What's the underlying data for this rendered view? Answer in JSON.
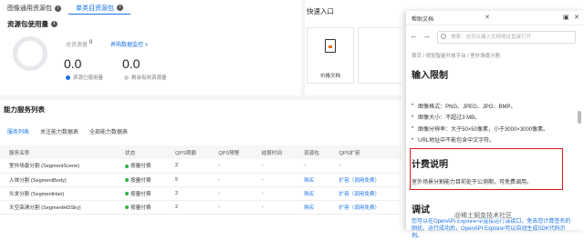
{
  "tabs": [
    {
      "label": "图像通用资源包",
      "active": false
    },
    {
      "label": "单类目资源包",
      "active": true
    }
  ],
  "usage": {
    "title": "资源包使用量",
    "total_label": "总资源量",
    "total_value": "0",
    "buy_link": "养购数据监控 >",
    "used_value": "0.0",
    "remaining_value": "0.0",
    "used_legend": "资源已使用量",
    "remaining_legend": "剩余有效资源量",
    "used_color": "#1a73e8",
    "remaining_color": "#e6e8eb"
  },
  "quick": {
    "title": "快速入口",
    "tile_label": "价格文档"
  },
  "ability": {
    "title": "能力服务列表",
    "subtabs": [
      "服务列表",
      "关注能力数据表",
      "全部能力数据表"
    ],
    "columns": [
      "服务名称",
      "状态",
      "QPS限额",
      "QPS预警",
      "结算时间",
      "资源包",
      "QPS扩容"
    ],
    "rows": [
      {
        "name": "室外场景分割 (SegmentScene)",
        "status": "按量付费",
        "qps": "2",
        "warn": "-",
        "time": "-",
        "pkg": "-",
        "expand": "-"
      },
      {
        "name": "人体分割 (SegmentBody)",
        "status": "按量付费",
        "qps": "5",
        "warn": "-",
        "time": "-",
        "pkg": "购买",
        "expand": "扩容（调用免费）"
      },
      {
        "name": "头发分割 (SegmentHair)",
        "status": "按量付费",
        "qps": "2",
        "warn": "-",
        "time": "-",
        "pkg": "购买",
        "expand": "扩容（调用免费）"
      },
      {
        "name": "天空高清分割 (SegmentHDSky)",
        "status": "按量付费",
        "qps": "2",
        "warn": "-",
        "time": "-",
        "pkg": "购买",
        "expand": "扩容（调用免费）"
      }
    ]
  },
  "help": {
    "title": "帮助文档",
    "search_placeholder": "搜索：也可以输入文档地址直接打开",
    "breadcrumb": "首页 / 视觉智能开放平台 / 室外场景分割",
    "section1": "输入限制",
    "bullets": [
      "图像格式：PNG、JPEG、JPG、BMP。",
      "图像大小：不超过3 MB。",
      "图像分辨率：大于50×50像素，小于3000×3000像素。",
      "URL地址中不能包含中文字符。"
    ],
    "section2": "计费说明",
    "billing_text": "室外场景分割能力目前处于公测期，可免费调用。",
    "section3": "调试",
    "debug_text": "您可以在OpenAPI Explorer中直接运行该接口，免去您计算签名的困扰。运行成功后，OpenAPI Explorer可以自动生成SDK代码示例。"
  },
  "watermark": "@稀土掘金技术社区"
}
